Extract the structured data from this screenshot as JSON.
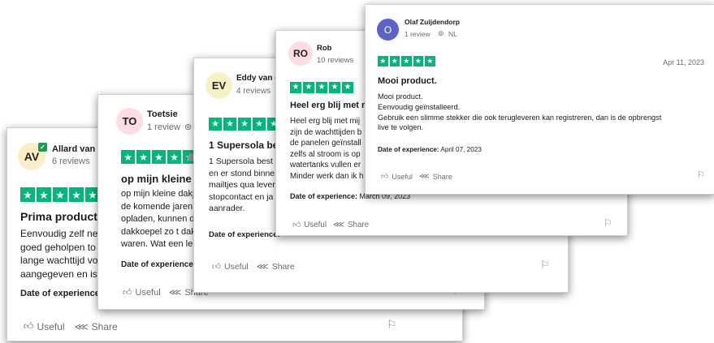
{
  "colors": {
    "star_green": "#00b67a",
    "verified_green": "#1a9a55"
  },
  "icons": {
    "star": "star-icon",
    "useful": "thumbs-up-icon",
    "share": "share-icon",
    "flag": "flag-icon",
    "location": "location-pin-icon"
  },
  "reviews": [
    {
      "initials": "AV",
      "name": "Allard van W",
      "review_count": "6 reviews",
      "rating": 5,
      "title": "Prima product,",
      "lines": [
        "Eenvoudig zelf ne",
        "goed geholpen to",
        "lange wachttijd vo",
        "aangegeven en is"
      ],
      "experience_label": "Date of experience",
      "experience_date": "",
      "useful_label": "Useful",
      "share_label": "Share"
    },
    {
      "initials": "TO",
      "name": "Toetsie",
      "review_count": "1 review",
      "rating": 5,
      "title": "op mijn kleine da",
      "lines": [
        "op mijn kleine dakje",
        "de komende jaren!",
        "opladen, kunnen de",
        "dakkoepel zo t dak",
        "waren. Wat een leu"
      ],
      "experience_label": "Date of experience:",
      "experience_date": "J",
      "useful_label": "Useful",
      "share_label": "Share"
    },
    {
      "initials": "EV",
      "name": "Eddy van d",
      "review_count": "4 reviews",
      "rating": 5,
      "title": "1 Supersola bes",
      "lines": [
        "1 Supersola best",
        "en er stond binne",
        "mailtjes qua lever",
        "stopcontact en ja",
        "aanrader."
      ],
      "experience_label": "Date of experience:",
      "experience_date": "",
      "useful_label": "Useful",
      "share_label": "Share"
    },
    {
      "initials": "RO",
      "name": "Rob",
      "review_count": "10 reviews",
      "rating": 5,
      "title": "Heel erg blij met r",
      "lines": [
        "Heel erg blij met mij",
        "zijn de wachttijden b",
        "de panelen geïnstall",
        "zelfs al stroom is op",
        "watertanks vullen er",
        "Minder werk dan ik h"
      ],
      "experience_label": "Date of experience:",
      "experience_date": "March 09, 2023",
      "useful_label": "Useful",
      "share_label": "Share"
    },
    {
      "initials": "O",
      "name": "Olaf Zuijdendorp",
      "review_count": "1 review",
      "country": "NL",
      "rating": 5,
      "date": "Apr 11, 2023",
      "title": "Mooi product.",
      "lines": [
        "Mooi product.",
        "Eenvoudig geïnstalleerd.",
        "Gebruik een slimme stekker die ook terugleveren kan registreren, dan is de opbrengst",
        "live te volgen."
      ],
      "experience_label": "Date of experience:",
      "experience_date": "April 07, 2023",
      "useful_label": "Useful",
      "share_label": "Share"
    }
  ]
}
